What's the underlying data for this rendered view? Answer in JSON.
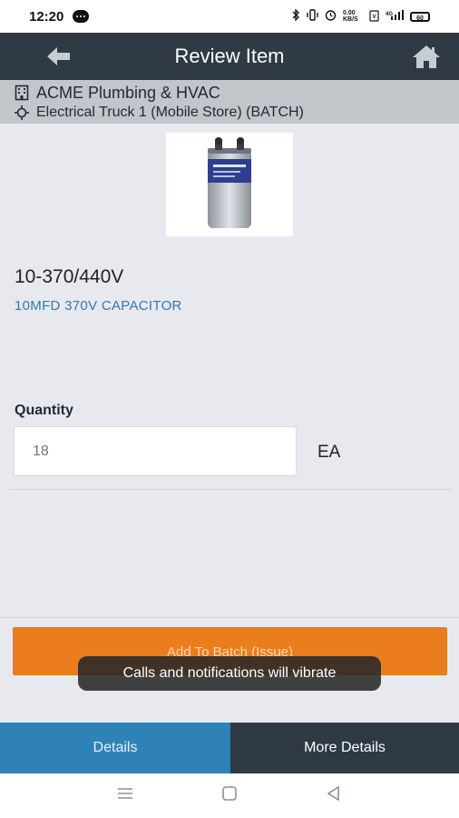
{
  "status_bar": {
    "time": "12:20",
    "icons": [
      "bluetooth-icon",
      "vibrate-icon",
      "alarm-icon",
      "network-speed-icon",
      "volte-icon",
      "wifi-icon",
      "signal-icon",
      "battery-icon"
    ],
    "network_speed": "0.00 KB/S",
    "battery": "60"
  },
  "appbar": {
    "title": "Review Item",
    "colors": {
      "background": "#2f3a44"
    }
  },
  "location": {
    "company": "ACME Plumbing & HVAC",
    "store": "Electrical Truck 1 (Mobile Store)  (BATCH)"
  },
  "item": {
    "code": "10-370/440V",
    "description": "10MFD 370V CAPACITOR",
    "image_label": "capacitor product image"
  },
  "quantity": {
    "label": "Quantity",
    "value": "",
    "placeholder": "18",
    "unit": "EA"
  },
  "actions": {
    "add_button": "Add To Batch (Issue)",
    "accent": "#ec7d1c"
  },
  "toast": {
    "message": "Calls and notifications will vibrate"
  },
  "tabs": [
    {
      "label": "Details",
      "active": true
    },
    {
      "label": "More Details",
      "active": false
    }
  ],
  "system_nav": [
    "menu-icon",
    "home-square-icon",
    "back-triangle-icon"
  ]
}
